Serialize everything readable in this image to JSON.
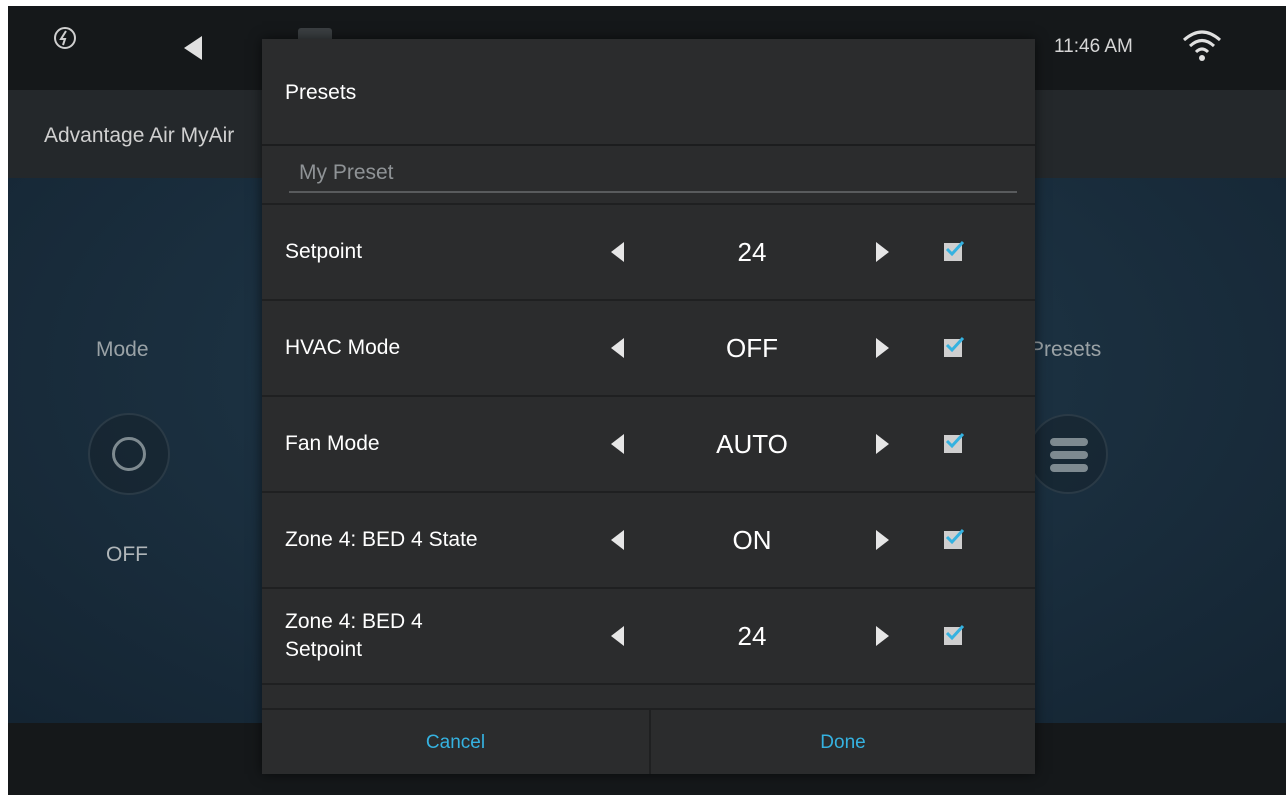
{
  "status_bar": {
    "time": "11:46 AM",
    "icons": [
      "app-logo-icon",
      "back-arrow-icon",
      "document-icon",
      "wifi-icon"
    ]
  },
  "app": {
    "title": "Advantage Air MyAir"
  },
  "background": {
    "mode_label": "Mode",
    "mode_value": "OFF",
    "presets_label": "Presets"
  },
  "dialog": {
    "title": "Presets",
    "name_placeholder": "My Preset",
    "rows": [
      {
        "label": "Setpoint",
        "value": "24",
        "checked": true
      },
      {
        "label": "HVAC Mode",
        "value": "OFF",
        "checked": true
      },
      {
        "label": "Fan Mode",
        "value": "AUTO",
        "checked": true
      },
      {
        "label": "Zone 4: BED 4 State",
        "value": "ON",
        "checked": true
      },
      {
        "label": "Zone 4: BED 4 Setpoint",
        "value": "24",
        "checked": true
      }
    ],
    "cancel_label": "Cancel",
    "done_label": "Done"
  },
  "colors": {
    "accent": "#35b2e0",
    "dialog_bg": "#2b2c2d",
    "checkmark": "#35b2e0"
  }
}
